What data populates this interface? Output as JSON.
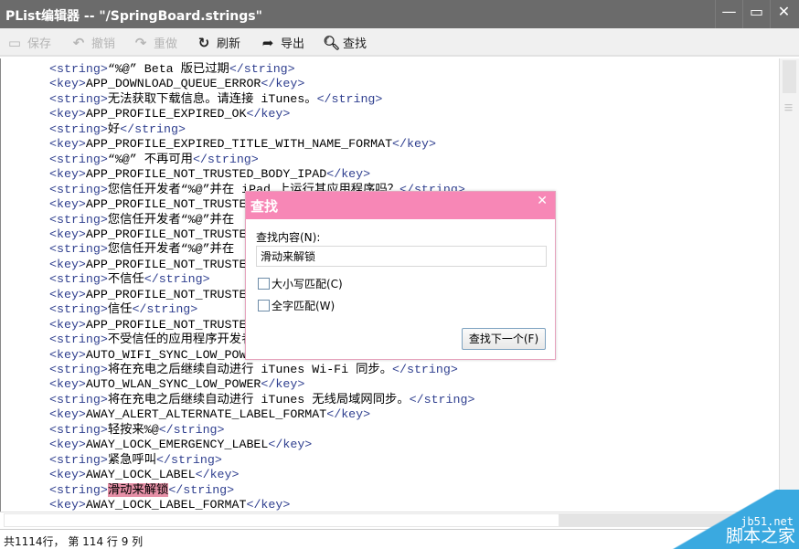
{
  "window": {
    "title": "PList编辑器 -- \"/SpringBoard.strings\"",
    "minimize": "—",
    "maximize": "▭",
    "close": "✕"
  },
  "toolbar": {
    "save": "保存",
    "undo": "撤销",
    "redo": "重做",
    "refresh": "刷新",
    "export": "导出",
    "find": "查找"
  },
  "lines": [
    {
      "o": "<string>",
      "t": "“%@” Beta 版已过期",
      "c": "</string>"
    },
    {
      "o": "<key>",
      "t": "APP_DOWNLOAD_QUEUE_ERROR",
      "c": "</key>"
    },
    {
      "o": "<string>",
      "t": "无法获取下载信息。请连接 iTunes。",
      "c": "</string>"
    },
    {
      "o": "<key>",
      "t": "APP_PROFILE_EXPIRED_OK",
      "c": "</key>"
    },
    {
      "o": "<string>",
      "t": "好",
      "c": "</string>"
    },
    {
      "o": "<key>",
      "t": "APP_PROFILE_EXPIRED_TITLE_WITH_NAME_FORMAT",
      "c": "</key>"
    },
    {
      "o": "<string>",
      "t": "“%@” 不再可用",
      "c": "</string>"
    },
    {
      "o": "<key>",
      "t": "APP_PROFILE_NOT_TRUSTED_BODY_IPAD",
      "c": "</key>"
    },
    {
      "o": "<string>",
      "t": "您信任开发者“%@”并在 iPad 上运行其应用程序吗？",
      "c": "</string>"
    },
    {
      "o": "<key>",
      "t": "APP_PROFILE_NOT_TRUSTE",
      "c": ""
    },
    {
      "o": "<string>",
      "t": "您信任开发者“%@”并在",
      "c": ""
    },
    {
      "o": "<key>",
      "t": "APP_PROFILE_NOT_TRUSTE",
      "c": ""
    },
    {
      "o": "<string>",
      "t": "您信任开发者“%@”并在",
      "c": ""
    },
    {
      "o": "<key>",
      "t": "APP_PROFILE_NOT_TRUSTE",
      "c": ""
    },
    {
      "o": "<string>",
      "t": "不信任",
      "c": "</string>"
    },
    {
      "o": "<key>",
      "t": "APP_PROFILE_NOT_TRUSTE",
      "c": ""
    },
    {
      "o": "<string>",
      "t": "信任",
      "c": "</string>"
    },
    {
      "o": "<key>",
      "t": "APP_PROFILE_NOT_TRUSTE",
      "c": ""
    },
    {
      "o": "<string>",
      "t": "不受信任的应用程序开发者",
      "c": ""
    },
    {
      "o": "<key>",
      "t": "AUTO_WIFI_SYNC_LOW_POW",
      "c": ""
    },
    {
      "o": "<string>",
      "t": "将在充电之后继续自动进行 iTunes Wi-Fi 同步。",
      "c": "</string>"
    },
    {
      "o": "<key>",
      "t": "AUTO_WLAN_SYNC_LOW_POWER",
      "c": "</key>"
    },
    {
      "o": "<string>",
      "t": "将在充电之后继续自动进行 iTunes 无线局域网同步。",
      "c": "</string>"
    },
    {
      "o": "<key>",
      "t": "AWAY_ALERT_ALTERNATE_LABEL_FORMAT",
      "c": "</key>"
    },
    {
      "o": "<string>",
      "t": "轻按来%@",
      "c": "</string>"
    },
    {
      "o": "<key>",
      "t": "AWAY_LOCK_EMERGENCY_LABEL",
      "c": "</key>"
    },
    {
      "o": "<string>",
      "t": "紧急呼叫",
      "c": "</string>"
    },
    {
      "o": "<key>",
      "t": "AWAY_LOCK_LABEL",
      "c": "</key>"
    },
    {
      "o": "<string>",
      "t": "滑动来解锁",
      "c": "</string>",
      "hl": true
    },
    {
      "o": "<key>",
      "t": "AWAY_LOCK_LABEL_FORMAT",
      "c": "</key>"
    }
  ],
  "status": "共1114行， 第 114 行 9 列",
  "find_dialog": {
    "title": "查找",
    "close": "✕",
    "label": "查找内容(N):",
    "value": "滑动来解锁",
    "match_case": "大小写匹配(C)",
    "whole_word": "全字匹配(W)",
    "find_next": "查找下一个(F)",
    "match_case_checked": false,
    "whole_word_checked": false
  },
  "watermark": {
    "domain": "jb51.net",
    "name": "脚本之家"
  },
  "colors": {
    "titlebar": "#6b6b6b",
    "dialog_header": "#f787b6",
    "highlight": "#e58fa6",
    "tag": "#2f3f8f"
  }
}
